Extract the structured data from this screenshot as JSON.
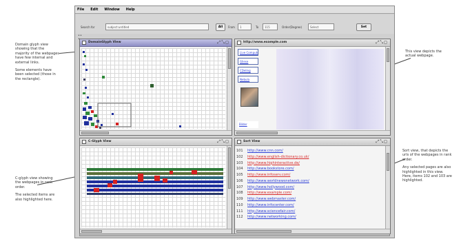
{
  "app": {
    "menu": [
      "File",
      "Edit",
      "Window",
      "Help"
    ],
    "toolbar": {
      "search_label": "Search for",
      "search_value": "subject:untitled",
      "all_button": "All",
      "from_label": "From",
      "from_value": "1",
      "to_label": "To",
      "to_value": "115",
      "order_label": "Order(Degree)",
      "order_value": "Select",
      "set_button": "Set"
    },
    "corner_icon": "•• •"
  },
  "panels": {
    "domain": {
      "title": "DomainGlyph View"
    },
    "web": {
      "title": "http://www.example.com",
      "side_links": [
        "Live Computer",
        "Gliese",
        "CDeling",
        "Nebula",
        "Bilder"
      ]
    },
    "cglyph": {
      "title": "C-Glyph View"
    },
    "sort": {
      "title": "Sort View",
      "rows": [
        {
          "num": "101",
          "url": "http://www.cnn.com/"
        },
        {
          "num": "102",
          "url": "http://www.english-dictionary.co.uk/"
        },
        {
          "num": "103",
          "url": "http://www.highinteractive.de/"
        },
        {
          "num": "104",
          "url": "http://www.bookstore.com/"
        },
        {
          "num": "105",
          "url": "http://www.infoserv.com/"
        },
        {
          "num": "106",
          "url": "http://www.worldnewsnetwork.com/"
        },
        {
          "num": "107",
          "url": "http://www.hollywood.com/"
        },
        {
          "num": "108",
          "url": "http://www.example.com/"
        },
        {
          "num": "109",
          "url": "http://www.webmaster.com/"
        },
        {
          "num": "110",
          "url": "http://www.infocenter.com/"
        },
        {
          "num": "111",
          "url": "http://www.sciencefair.com/"
        },
        {
          "num": "112",
          "url": "http://www.networking.com/"
        }
      ]
    }
  },
  "annotations": {
    "domain_1": "Domain glyph view showing that the majority of the webpages have few internal and external links.",
    "domain_2": "Some elements have been selected (those in the rectangle).",
    "web": "This view depicts the actual webpage.",
    "cglyph_1": "C-glyph view showing the webpages in rank order.",
    "cglyph_2": "The selected items are also highlighted here.",
    "sort_1": "Sort view, that depicts the urls of the webpages in rank order.",
    "sort_2": "Any selected pages are also highlighted in this view. Here, items 102 and 103 are highlighted."
  },
  "colors": {
    "link": "#2d3fd6",
    "selected_link": "#d82b2b",
    "title_active": "#9b9bcc",
    "glyph_blue": "#1f2f9c",
    "glyph_green": "#2f8a3a",
    "glyph_red": "#d52020",
    "glyph_gray": "#3a3a5a"
  }
}
